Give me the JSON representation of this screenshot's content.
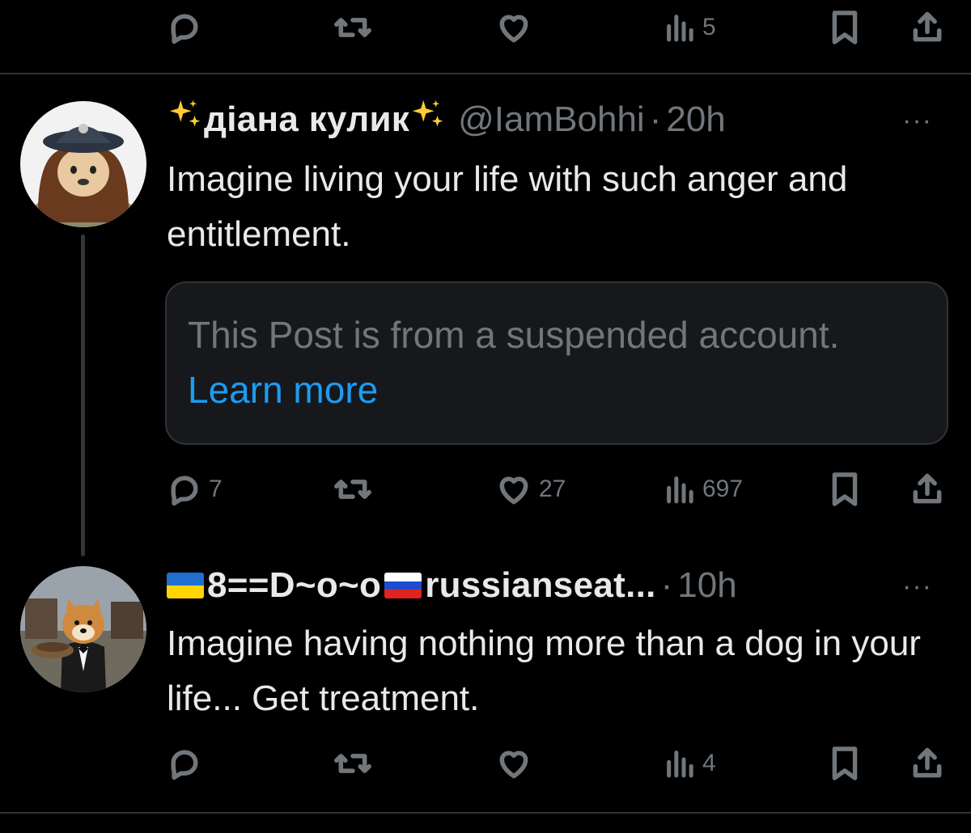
{
  "colors": {
    "background": "#000000",
    "text_primary": "#e7e9ea",
    "text_secondary": "#71767b",
    "divider": "#2f3336",
    "link": "#1d9bf0",
    "quote_bg": "#16181c"
  },
  "top_actions": {
    "reply_count": "",
    "repost_count": "",
    "like_count": "",
    "view_count": "5"
  },
  "post1": {
    "display_name": "діана кулик",
    "name_emoji": "sparkles-icon",
    "handle": "@IamBohhi",
    "separator": "·",
    "time": "20h",
    "more": "···",
    "text": "Imagine living your life with such anger and entitlement.",
    "quote": {
      "text": "This Post is from a suspended account.",
      "link": "Learn more"
    },
    "actions": {
      "reply_count": "7",
      "repost_count": "",
      "like_count": "27",
      "view_count": "697"
    }
  },
  "post2": {
    "display_name": "8==D~o~o",
    "display_name_suffix": "russianseat...",
    "flags": [
      "ukraine-flag",
      "russia-flag"
    ],
    "separator": "·",
    "time": "10h",
    "more": "···",
    "text": "Imagine having nothing more than a dog in your life... Get treatment.",
    "actions": {
      "reply_count": "",
      "repost_count": "",
      "like_count": "",
      "view_count": "4"
    }
  }
}
